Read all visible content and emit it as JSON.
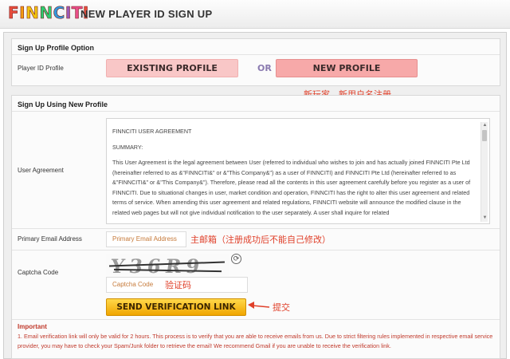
{
  "header": {
    "logo_text": "FINNCITI",
    "title": "NEW PLAYER ID SIGN UP"
  },
  "profile_option": {
    "section_title": "Sign Up Profile Option",
    "row_label": "Player ID Profile",
    "existing_label": "EXISTING PROFILE",
    "or_label": "OR",
    "new_label": "NEW PROFILE",
    "annotation": "新玩家、新用户名注册"
  },
  "new_profile": {
    "section_title": "Sign Up Using New Profile",
    "agreement_label": "User Agreement",
    "agreement": {
      "heading": "FINNCITI USER AGREEMENT",
      "summary": "SUMMARY:",
      "body": "This User Agreement is the legal agreement between User (referred to individual who wishes to join and has actually joined FINNCITI Pte Ltd (hereinafter referred to as &\"FINNCITI&\" or &\"This Company&\") as a user of FINNCITI) and FINNCITI Pte Ltd (hereinafter referred to as &\"FINNCITI&\" or &\"This Company&\"). Therefore, please read all the contents in this user agreement carefully before you register as a user of FINNCITI. Due to situational changes in user, market condition and operation, FINNCITI has the right to alter this user agreement and related terms of service. When amending this user agreement and related regulations, FINNCITI website will announce the modified clause in the related web pages but will not give individual notification to the user separately. A user shall inquire for related"
    },
    "email_label": "Primary Email Address",
    "email_placeholder": "Primary Email Address",
    "email_annotation": "主邮箱（注册成功后不能自己修改）",
    "captcha_label": "Captcha Code",
    "captcha_value": "Y36R9",
    "captcha_placeholder": "Captcha Code",
    "captcha_annotation": "验证码",
    "send_label": "SEND VERIFICATION LINK",
    "send_annotation": "提交"
  },
  "important": {
    "title": "Important",
    "text": "1.  Email verification link will only be valid for 2 hours. This process is to verify that you are able to receive emails from us. Due to strict filtering rules implemented in respective email service provider, you may have to check your Spam/Junk folder to retrieve the email! We recommend Gmail if you are unable to receive the verification link."
  },
  "colors": {
    "annotation": "#e0402a",
    "important": "#c0392b",
    "send_button": "#f5b800",
    "profile_buttons": "#f9c7c7"
  }
}
